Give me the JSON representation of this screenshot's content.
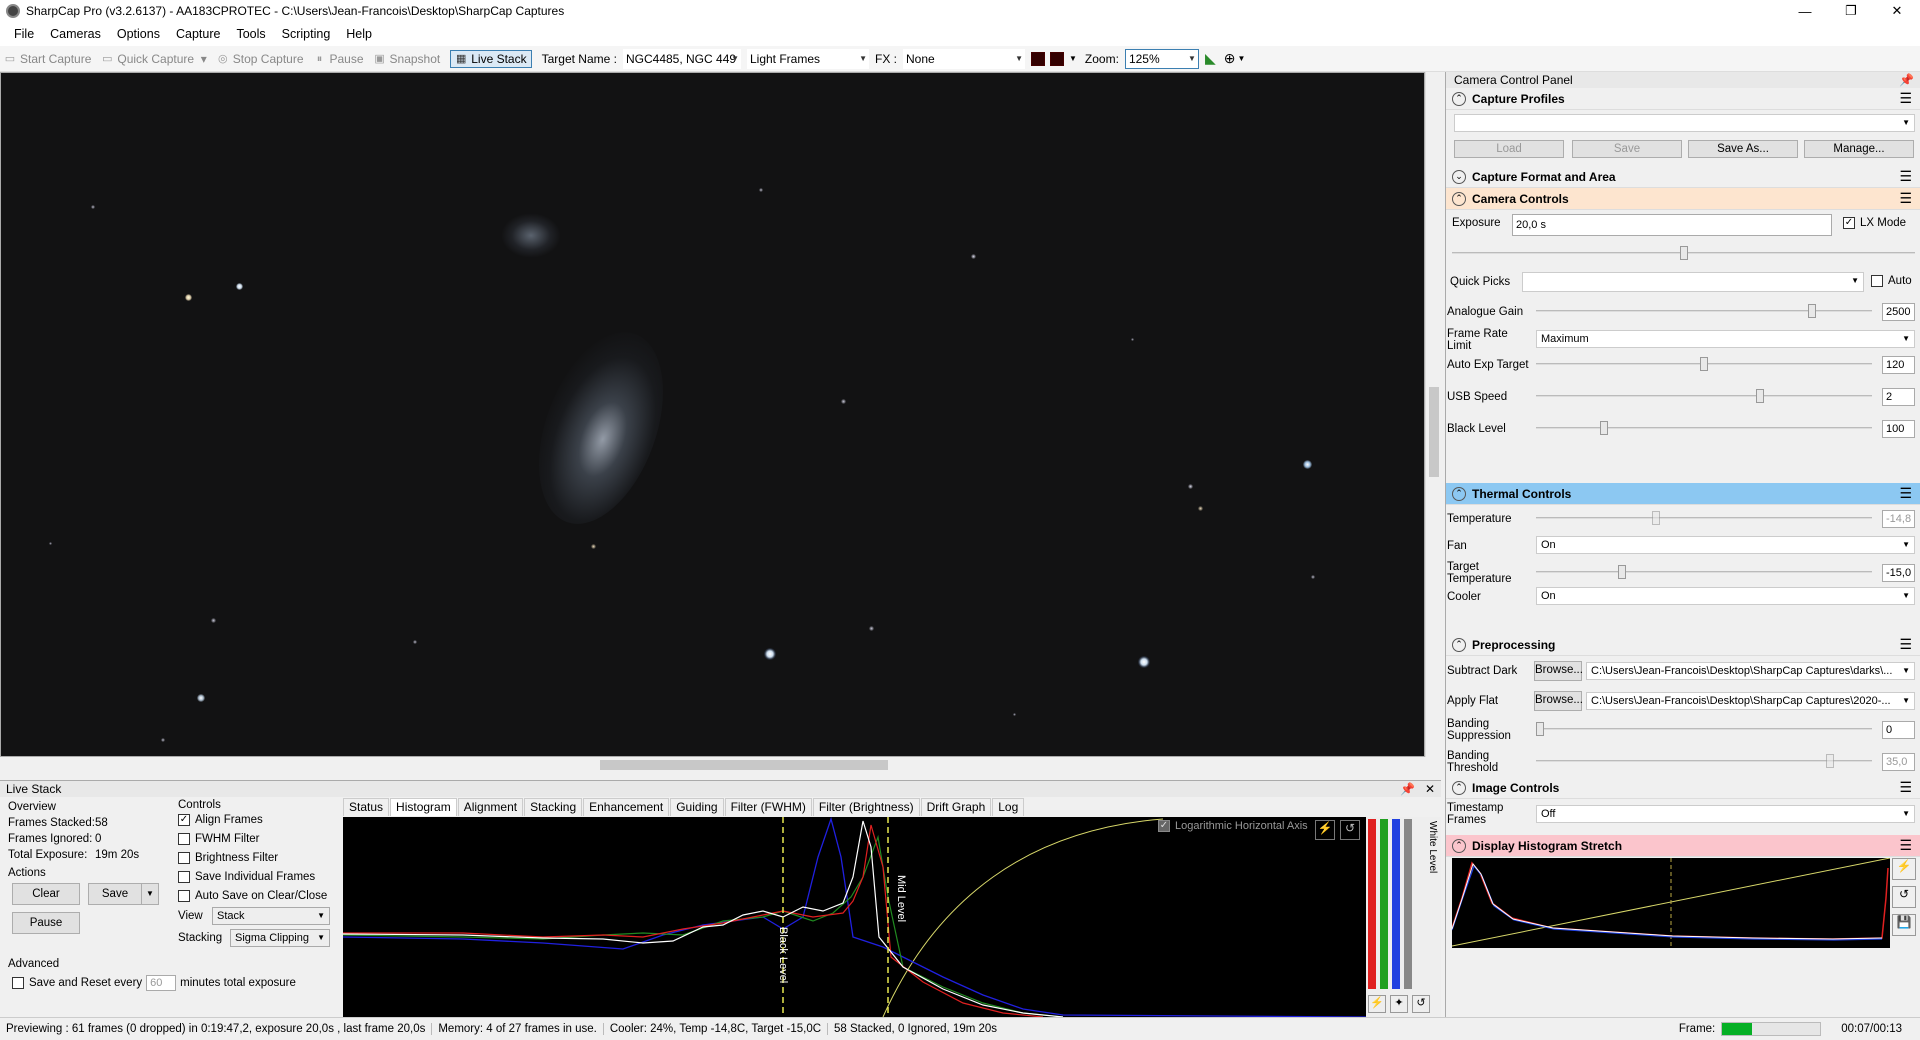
{
  "window": {
    "title": "SharpCap Pro (v3.2.6137) - AA183CPROTEC - C:\\Users\\Jean-Francois\\Desktop\\SharpCap Captures",
    "min": "—",
    "max": "❐",
    "close": "✕"
  },
  "menu": [
    "File",
    "Cameras",
    "Options",
    "Capture",
    "Tools",
    "Scripting",
    "Help"
  ],
  "toolbar": {
    "start_capture": "Start Capture",
    "quick_capture": "Quick Capture",
    "stop_capture": "Stop Capture",
    "pause": "Pause",
    "snapshot": "Snapshot",
    "live_stack": "Live Stack",
    "target_label": "Target Name :",
    "target_value": "NGC4485, NGC 449",
    "frames_value": "Light Frames",
    "fx_label": "FX :",
    "fx_value": "None",
    "zoom_label": "Zoom:",
    "zoom_value": "125%"
  },
  "panel": {
    "title": "Camera Control Panel",
    "capture_profiles": "Capture Profiles",
    "load": "Load",
    "save": "Save",
    "save_as": "Save As...",
    "manage": "Manage...",
    "capture_format": "Capture Format and Area",
    "camera_controls": "Camera Controls",
    "exposure_label": "Exposure",
    "exposure_value": "20,0 s",
    "lx_mode": "LX Mode",
    "quick_picks": "Quick Picks",
    "auto": "Auto",
    "gain_label": "Analogue Gain",
    "gain_value": "2500",
    "framerate_label": "Frame Rate Limit",
    "framerate_value": "Maximum",
    "autoexp_label": "Auto Exp Target",
    "autoexp_value": "120",
    "usb_label": "USB Speed",
    "usb_value": "2",
    "black_label": "Black Level",
    "black_value": "100",
    "thermal": "Thermal Controls",
    "temp_label": "Temperature",
    "temp_value": "-14,8",
    "fan_label": "Fan",
    "fan_value": "On",
    "target_temp_label": "Target Temperature",
    "target_temp_value": "-15,0",
    "cooler_label": "Cooler",
    "cooler_value": "On",
    "preprocessing": "Preprocessing",
    "dark_label": "Subtract Dark",
    "browse": "Browse...",
    "dark_value": "C:\\Users\\Jean-Francois\\Desktop\\SharpCap Captures\\darks\\...",
    "flat_label": "Apply Flat",
    "flat_value": "C:\\Users\\Jean-Francois\\Desktop\\SharpCap Captures\\2020-...",
    "banding_label": "Banding Suppression",
    "banding_value": "0",
    "bthresh_label": "Banding Threshold",
    "bthresh_value": "35,0",
    "image_controls": "Image Controls",
    "timestamp_label": "Timestamp Frames",
    "timestamp_value": "Off",
    "histo_stretch": "Display Histogram Stretch"
  },
  "livestack": {
    "title": "Live Stack",
    "overview": "Overview",
    "frames_stacked_label": "Frames Stacked:",
    "frames_stacked": "58",
    "frames_ignored_label": "Frames Ignored:",
    "frames_ignored": "0",
    "total_exposure_label": "Total Exposure:",
    "total_exposure": "19m 20s",
    "actions": "Actions",
    "clear": "Clear",
    "save": "Save",
    "pause": "Pause",
    "advanced": "Advanced",
    "save_reset": "Save and Reset every",
    "minutes_value": "60",
    "minutes_label": "minutes total exposure",
    "controls": "Controls",
    "align": "Align Frames",
    "fwhm": "FWHM Filter",
    "brightness": "Brightness Filter",
    "save_individual": "Save Individual Frames",
    "autosave": "Auto Save on Clear/Close",
    "view_label": "View",
    "view_value": "Stack",
    "stacking_label": "Stacking",
    "stacking_value": "Sigma Clipping",
    "tabs": [
      "Status",
      "Histogram",
      "Alignment",
      "Stacking",
      "Enhancement",
      "Guiding",
      "Filter (FWHM)",
      "Filter (Brightness)",
      "Drift Graph",
      "Log"
    ],
    "log_axis": "Logarithmic Horizontal Axis",
    "black_level": "Black Level",
    "mid_level": "Mid Level",
    "white_level": "White Level"
  },
  "status": {
    "preview": "Previewing : 61 frames (0 dropped) in 0:19:47,2, exposure 20,0s , last frame 20,0s",
    "memory": "Memory: 4 of 27 frames in use.",
    "cooler": "Cooler: 24%, Temp -14,8C, Target -15,0C",
    "stacked": "58 Stacked, 0 Ignored, 19m 20s",
    "frame_label": "Frame:",
    "frame_progress": 0.3,
    "time": "00:07/00:13"
  }
}
